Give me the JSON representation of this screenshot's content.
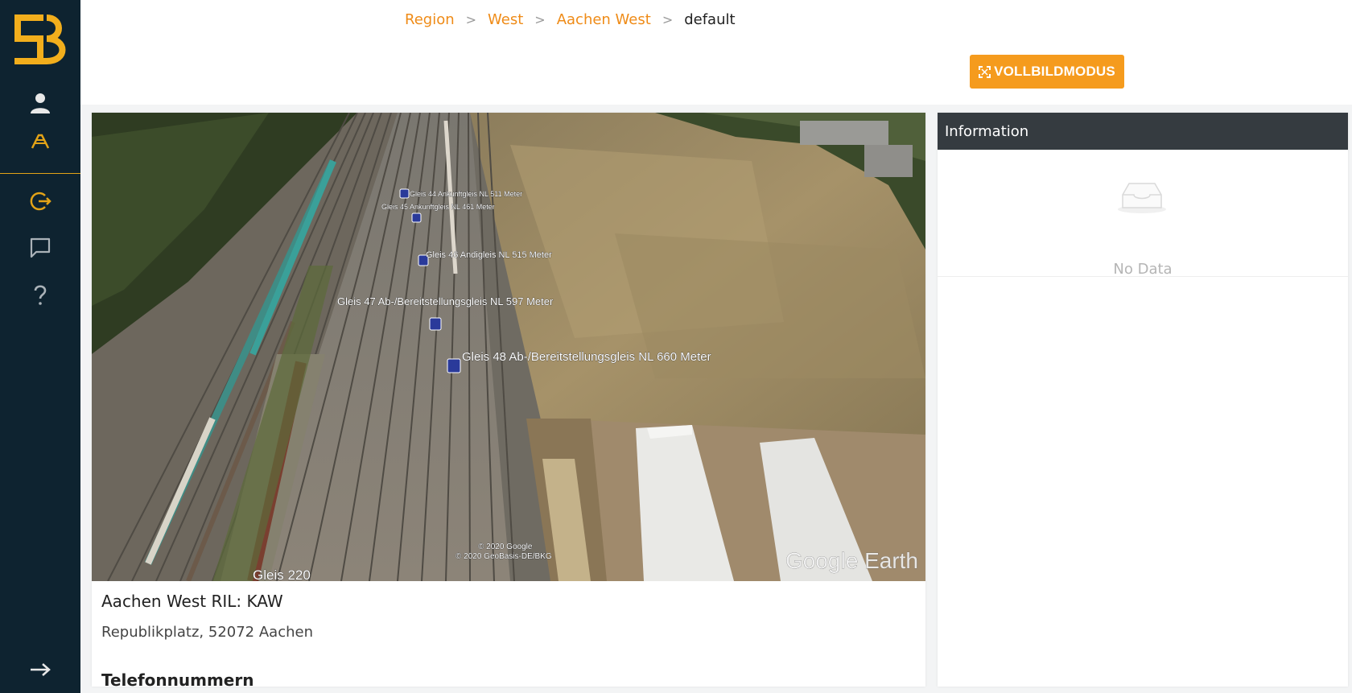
{
  "breadcrumb": {
    "items": [
      "Region",
      "West",
      "Aachen West"
    ],
    "current": "default",
    "separator": ">"
  },
  "toolbar": {
    "fullscreen_label": "VOLLBILDMODUS",
    "fullscreen_icon": "expand-icon"
  },
  "sidebar": {
    "icons": [
      "user-icon",
      "tracks-icon",
      "logout-icon",
      "chat-icon",
      "help-icon",
      "expand-arrow-icon"
    ],
    "accent": "#e3a317"
  },
  "map": {
    "labels": [
      "Gleis 44 Ankunftgleis NL 511 Meter",
      "Gleis 45 Ankunftgleis NL 461 Meter",
      "Gleis 46 Andigleis NL 515 Meter",
      "Gleis 47 Ab-/Bereitstellungsgleis NL 597 Meter",
      "Gleis 48 Ab-/Bereitstellungsgleis  NL 660 Meter",
      "Gleis 220"
    ],
    "copyright": [
      "© 2020 Google",
      "© 2020 GeoBasis-DE/BKG"
    ],
    "watermark": "Google Earth"
  },
  "station": {
    "title": "Aachen West RIL: KAW",
    "address": "Republikplatz, 52072 Aachen",
    "section": "Telefonnummern"
  },
  "info": {
    "header": "Information",
    "empty_text": "No Data"
  },
  "colors": {
    "accent": "#f59b1d",
    "sidebar": "#0e2330",
    "header": "#353b40"
  }
}
